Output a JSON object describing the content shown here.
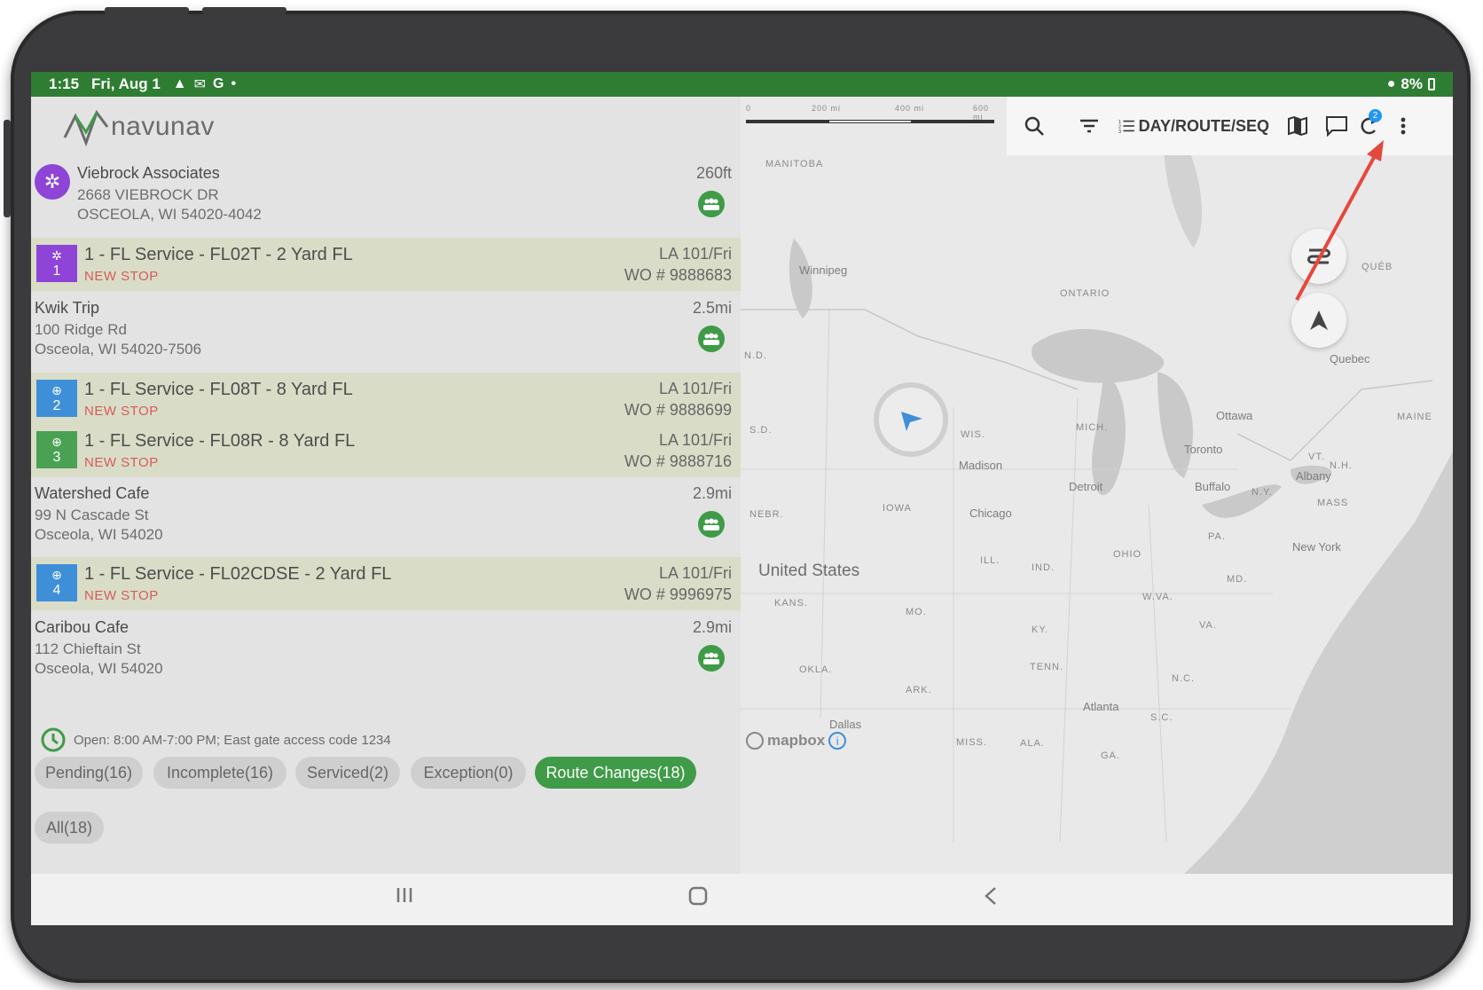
{
  "status_bar": {
    "time": "1:15",
    "date": "Fri, Aug 1",
    "battery": "8%"
  },
  "app": {
    "logo_text": "navunav"
  },
  "toolbar": {
    "sort_label": "DAY/ROUTE/SEQ",
    "notification_count": "2"
  },
  "stops": [
    {
      "name": "Viebrock Associates",
      "address_line1": "2668 VIEBROCK DR",
      "address_line2": "OSCEOLA, WI 54020-4042",
      "distance": "260ft"
    },
    {
      "name": "Kwik Trip",
      "address_line1": "100 Ridge Rd",
      "address_line2": "Osceola, WI 54020-7506",
      "distance": "2.5mi"
    },
    {
      "name": "Watershed Cafe",
      "address_line1": "99 N Cascade St",
      "address_line2": "Osceola, WI 54020",
      "distance": "2.9mi"
    },
    {
      "name": "Caribou Cafe",
      "address_line1": "112 Chieftain St",
      "address_line2": "Osceola, WI 54020",
      "distance": "2.9mi"
    }
  ],
  "services": [
    {
      "seq": "1",
      "title": "1 - FL Service - FL02T - 2 Yard FL",
      "status": "NEW STOP",
      "day": "LA 101/Fri",
      "wo": "WO # 9888683",
      "color": "#8e44d6"
    },
    {
      "seq": "2",
      "title": "1 - FL Service - FL08T - 8 Yard FL",
      "status": "NEW STOP",
      "day": "LA 101/Fri",
      "wo": "WO # 9888699",
      "color": "#3f8fd8"
    },
    {
      "seq": "3",
      "title": "1 - FL Service - FL08R - 8 Yard FL",
      "status": "NEW STOP",
      "day": "LA 101/Fri",
      "wo": "WO # 9888716",
      "color": "#4aa153"
    },
    {
      "seq": "4",
      "title": "1 - FL Service - FL02CDSE - 2 Yard FL",
      "status": "NEW STOP",
      "day": "LA 101/Fri",
      "wo": "WO # 9996975",
      "color": "#3f8fd8"
    }
  ],
  "hours_note": "Open: 8:00 AM-7:00 PM; East gate access code 1234",
  "filters": [
    {
      "label": "Pending(16)",
      "active": false
    },
    {
      "label": "Incomplete(16)",
      "active": false
    },
    {
      "label": "Serviced(2)",
      "active": false
    },
    {
      "label": "Exception(0)",
      "active": false
    },
    {
      "label": "Route Changes(18)",
      "active": true
    },
    {
      "label": "All(18)",
      "active": false
    }
  ],
  "map": {
    "scale_labels": [
      "0",
      "200 mi",
      "400 mi",
      "600 mi"
    ],
    "regions": [
      "MANITOBA",
      "ONTARIO",
      "QUÉB",
      "N.D.",
      "S.D.",
      "WIS.",
      "MICH.",
      "IOWA",
      "NEBR.",
      "ILL.",
      "IND.",
      "OHIO",
      "PA.",
      "N.Y.",
      "VT.",
      "N.H.",
      "MAINE",
      "MASS",
      "MD.",
      "W.VA.",
      "VA.",
      "KY.",
      "KANS.",
      "MO.",
      "OKLA.",
      "ARK.",
      "TENN.",
      "N.C.",
      "S.C.",
      "MISS.",
      "ALA.",
      "GA."
    ],
    "country": "United States",
    "cities": [
      "Winnipeg",
      "Madison",
      "Chicago",
      "Detroit",
      "Toronto",
      "Buffalo",
      "Albany",
      "Ottawa",
      "Quebec",
      "New York",
      "Atlanta",
      "Dallas"
    ],
    "attribution": "mapbox"
  },
  "colors": {
    "status_bar": "#2e7d32",
    "accent_green": "#3f9b47",
    "new_stop": "#d65b5b",
    "service_bg": "#d9ddc7",
    "arrow": "#e5483c"
  }
}
